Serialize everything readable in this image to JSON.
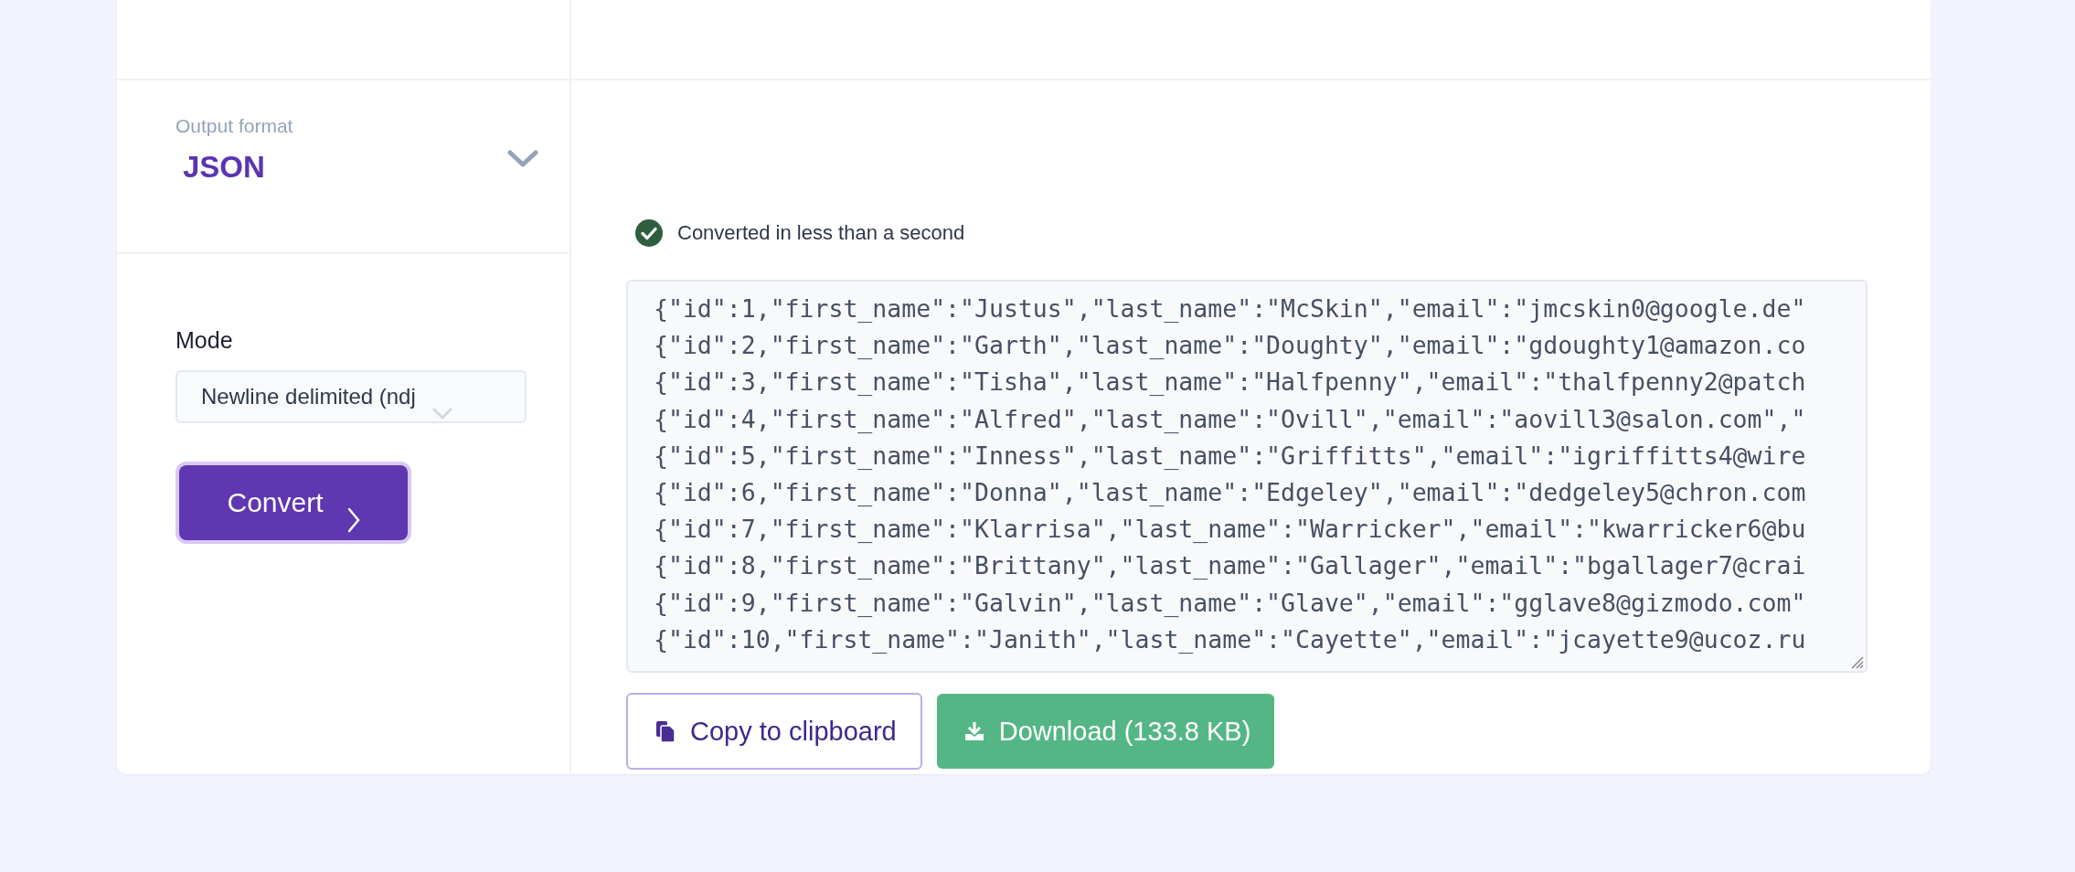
{
  "output_format": {
    "label": "Output format",
    "value": "JSON"
  },
  "mode": {
    "label": "Mode",
    "value": "Newline delimited (ndj"
  },
  "convert_button": {
    "label": "Convert"
  },
  "status": {
    "text": "Converted in less than a second"
  },
  "output_lines": [
    "{\"id\":1,\"first_name\":\"Justus\",\"last_name\":\"McSkin\",\"email\":\"jmcskin0@google.de\"",
    "{\"id\":2,\"first_name\":\"Garth\",\"last_name\":\"Doughty\",\"email\":\"gdoughty1@amazon.co",
    "{\"id\":3,\"first_name\":\"Tisha\",\"last_name\":\"Halfpenny\",\"email\":\"thalfpenny2@patch",
    "{\"id\":4,\"first_name\":\"Alfred\",\"last_name\":\"Ovill\",\"email\":\"aovill3@salon.com\",\"",
    "{\"id\":5,\"first_name\":\"Inness\",\"last_name\":\"Griffitts\",\"email\":\"igriffitts4@wire",
    "{\"id\":6,\"first_name\":\"Donna\",\"last_name\":\"Edgeley\",\"email\":\"dedgeley5@chron.com",
    "{\"id\":7,\"first_name\":\"Klarrisa\",\"last_name\":\"Warricker\",\"email\":\"kwarricker6@bu",
    "{\"id\":8,\"first_name\":\"Brittany\",\"last_name\":\"Gallager\",\"email\":\"bgallager7@crai",
    "{\"id\":9,\"first_name\":\"Galvin\",\"last_name\":\"Glave\",\"email\":\"gglave8@gizmodo.com\"",
    "{\"id\":10,\"first_name\":\"Janith\",\"last_name\":\"Cayette\",\"email\":\"jcayette9@ucoz.ru"
  ],
  "actions": [
    {
      "kind": "copy",
      "label": "Copy to clipboard"
    },
    {
      "kind": "download",
      "label": "Download (133.8 KB)"
    }
  ]
}
